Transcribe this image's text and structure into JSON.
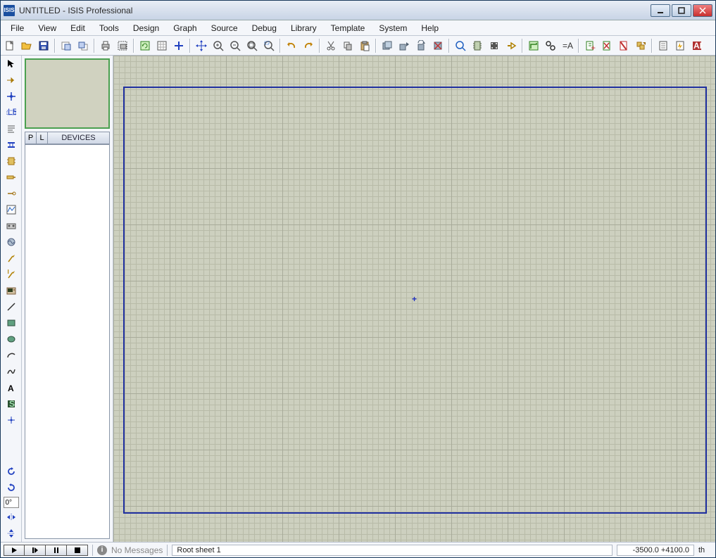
{
  "title": "UNTITLED - ISIS Professional",
  "app_icon_text": "ISIS",
  "menu": [
    "File",
    "View",
    "Edit",
    "Tools",
    "Design",
    "Graph",
    "Source",
    "Debug",
    "Library",
    "Template",
    "System",
    "Help"
  ],
  "sidepanel": {
    "tab_p": "P",
    "tab_l": "L",
    "devices_header": "DEVICES"
  },
  "angle_value": "0°",
  "status": {
    "no_messages": "No Messages",
    "sheet": "Root sheet 1",
    "coords": "-3500.0  +4100.0",
    "unit": "th"
  }
}
